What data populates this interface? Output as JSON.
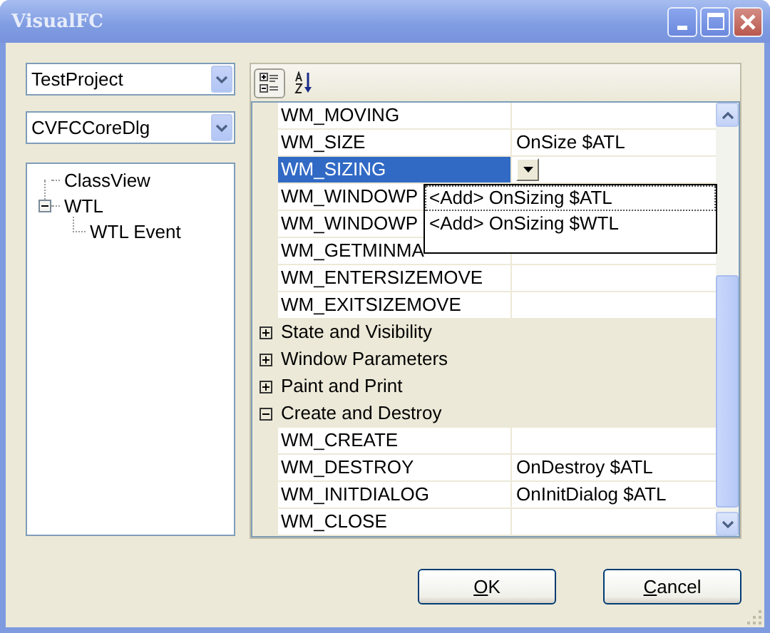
{
  "window": {
    "title": "VisualFC"
  },
  "project_combo": {
    "value": "TestProject"
  },
  "class_combo": {
    "value": "CVFCCoreDlg"
  },
  "tree": [
    {
      "label": "ClassView"
    },
    {
      "label": "WTL",
      "expanded": true,
      "children": [
        {
          "label": "WTL Event"
        }
      ]
    }
  ],
  "toolbar": [
    {
      "kind": "categorized",
      "selected": true
    },
    {
      "kind": "alphabetical",
      "selected": false
    }
  ],
  "grid": {
    "rows": [
      {
        "kind": "item",
        "name": "WM_MOVING",
        "selected": false
      },
      {
        "kind": "item",
        "name": "WM_SIZE",
        "value": "OnSize $ATL",
        "selected": false
      },
      {
        "kind": "item",
        "name": "WM_SIZING",
        "selected": true
      },
      {
        "kind": "item",
        "name": "WM_WINDOWP",
        "selected": false
      },
      {
        "kind": "item",
        "name": "WM_WINDOWP",
        "selected": false
      },
      {
        "kind": "item",
        "name": "WM_GETMINMA",
        "selected": false
      },
      {
        "kind": "item",
        "name": "WM_ENTERSIZEMOVE",
        "selected": false
      },
      {
        "kind": "item",
        "name": "WM_EXITSIZEMOVE",
        "selected": false
      },
      {
        "kind": "category",
        "name": "State and Visibility",
        "expanded": false
      },
      {
        "kind": "category",
        "name": "Window Parameters",
        "expanded": false
      },
      {
        "kind": "category",
        "name": "Paint and Print",
        "expanded": false
      },
      {
        "kind": "category",
        "name": "Create and Destroy",
        "expanded": true
      },
      {
        "kind": "item",
        "name": "WM_CREATE",
        "selected": false
      },
      {
        "kind": "item",
        "name": "WM_DESTROY",
        "value": "OnDestroy $ATL",
        "selected": false
      },
      {
        "kind": "item",
        "name": "WM_INITDIALOG",
        "value": "OnInitDialog $ATL",
        "selected": false
      },
      {
        "kind": "item",
        "name": "WM_CLOSE",
        "selected": false
      }
    ]
  },
  "dropdown": {
    "options": [
      {
        "label": "<Add> OnSizing $ATL",
        "selected": true
      },
      {
        "label": "<Add> OnSizing $WTL",
        "selected": false
      }
    ]
  },
  "buttons": [
    "OK",
    "Cancel"
  ]
}
